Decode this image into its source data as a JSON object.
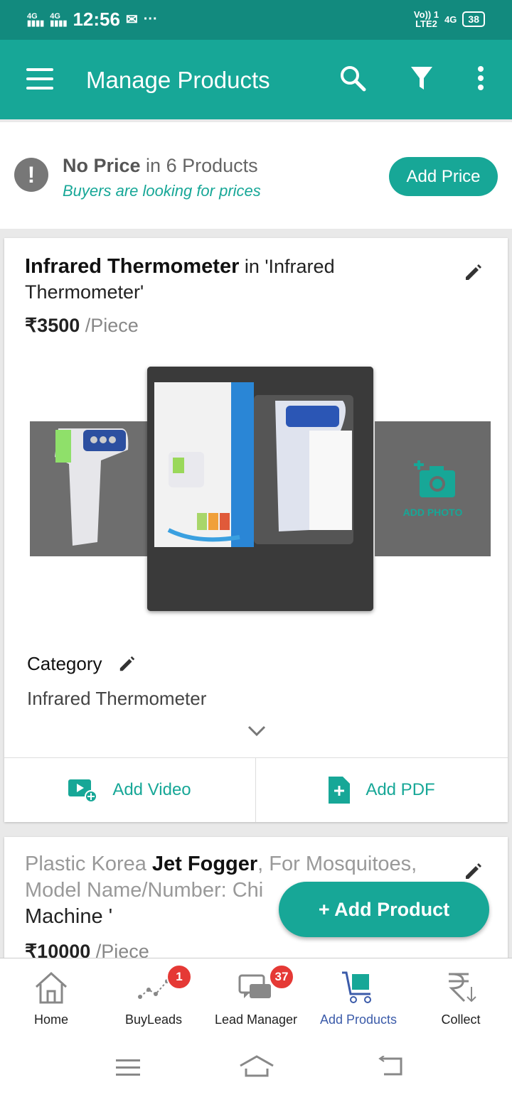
{
  "status": {
    "time": "12:56",
    "network_left": "4G",
    "network_right": "4G",
    "volte": "Vo)) 1",
    "lte": "LTE2",
    "battery": "38",
    "dots": "···"
  },
  "appbar": {
    "title": "Manage Products"
  },
  "notice": {
    "bold": "No Price",
    "rest": " in 6 Products",
    "sub": "Buyers are looking for prices",
    "button": "Add Price"
  },
  "product1": {
    "name_bold": "Infrared Thermometer",
    "name_rest": " in 'Infrared Thermometer'",
    "price": "₹3500",
    "unit": " /Piece",
    "add_photo": "ADD PHOTO",
    "category_label": "Category",
    "category_value": "Infrared Thermometer",
    "add_video": "Add Video",
    "add_pdf": "Add PDF"
  },
  "product2": {
    "name_pre": "Plastic Korea ",
    "name_bold": "Jet Fogger",
    "name_rest": ", For Mosquitoes,",
    "line2": "Model Name/Number: Chi",
    "line3": "Machine '",
    "price": "₹10000",
    "unit": " /Piece"
  },
  "fab": {
    "label": "+ Add Product"
  },
  "nav": [
    {
      "label": "Home"
    },
    {
      "label": "BuyLeads",
      "badge": "1"
    },
    {
      "label": "Lead Manager",
      "badge": "37"
    },
    {
      "label": "Add Products"
    },
    {
      "label": "Collect"
    }
  ],
  "colors": {
    "primary": "#17a797",
    "statusbar": "#128a7e",
    "badge": "#e53935",
    "active_nav": "#3b5ba9"
  }
}
